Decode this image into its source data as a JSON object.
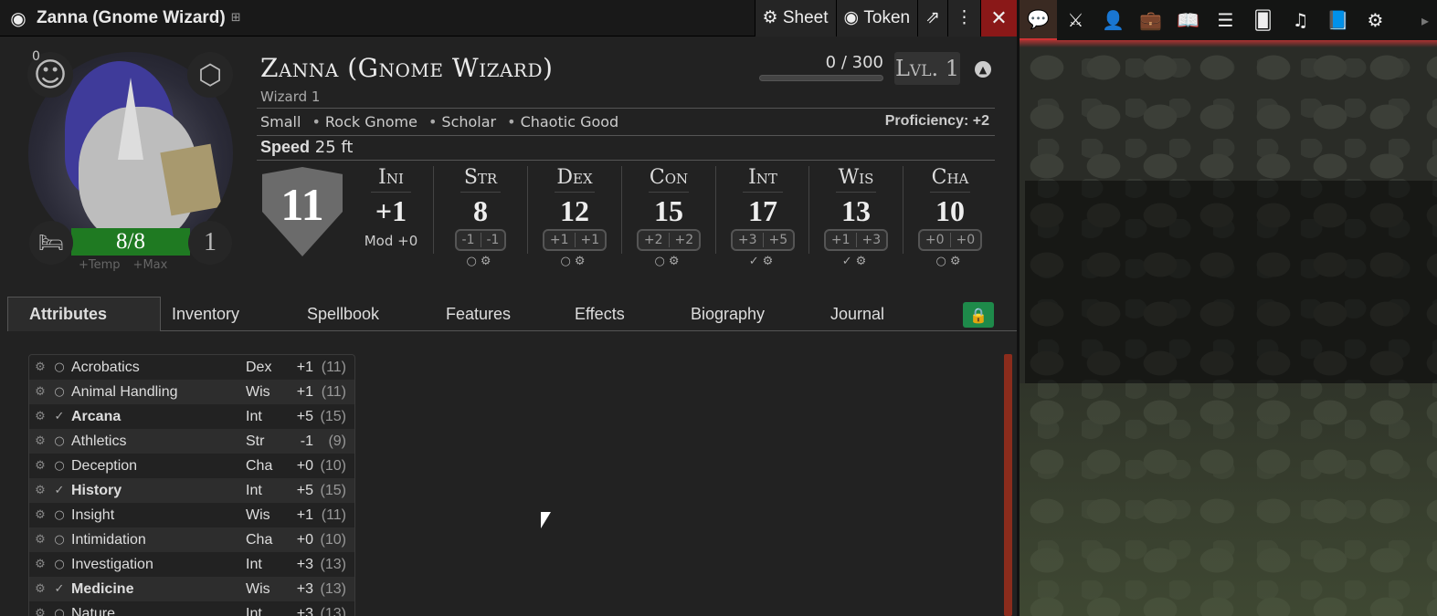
{
  "window": {
    "title": "Zanna (Gnome Wizard)",
    "sheet_label": "Sheet",
    "token_label": "Token"
  },
  "header": {
    "name": "Zanna (Gnome Wizard)",
    "class_line": "Wizard 1",
    "xp": "0 / 300",
    "level": "Lvl. 1",
    "inspiration": "0",
    "hp": "8/8",
    "exhaustion": "1",
    "temp_label": "+Temp",
    "max_label": "+Max",
    "traits": [
      "Small",
      "Rock Gnome",
      "Scholar",
      "Chaotic Good"
    ],
    "proficiency": "Proficiency: +2",
    "speed_label": "Speed",
    "speed_value": "25 ft",
    "ac": "11"
  },
  "initiative": {
    "label": "Ini",
    "value": "+1",
    "mod": "Mod +0"
  },
  "abilities": [
    {
      "label": "Str",
      "score": "8",
      "mod": "-1",
      "save": "-1",
      "proficient": false
    },
    {
      "label": "Dex",
      "score": "12",
      "mod": "+1",
      "save": "+1",
      "proficient": false
    },
    {
      "label": "Con",
      "score": "15",
      "mod": "+2",
      "save": "+2",
      "proficient": false
    },
    {
      "label": "Int",
      "score": "17",
      "mod": "+3",
      "save": "+5",
      "proficient": true
    },
    {
      "label": "Wis",
      "score": "13",
      "mod": "+1",
      "save": "+3",
      "proficient": true
    },
    {
      "label": "Cha",
      "score": "10",
      "mod": "+0",
      "save": "+0",
      "proficient": false
    }
  ],
  "tabs": [
    "Attributes",
    "Inventory",
    "Spellbook",
    "Features",
    "Effects",
    "Biography",
    "Journal"
  ],
  "skills": [
    {
      "name": "Acrobatics",
      "ability": "Dex",
      "mod": "+1",
      "passive": "(11)",
      "prof": false
    },
    {
      "name": "Animal Handling",
      "ability": "Wis",
      "mod": "+1",
      "passive": "(11)",
      "prof": false
    },
    {
      "name": "Arcana",
      "ability": "Int",
      "mod": "+5",
      "passive": "(15)",
      "prof": true
    },
    {
      "name": "Athletics",
      "ability": "Str",
      "mod": "-1",
      "passive": "(9)",
      "prof": false
    },
    {
      "name": "Deception",
      "ability": "Cha",
      "mod": "+0",
      "passive": "(10)",
      "prof": false
    },
    {
      "name": "History",
      "ability": "Int",
      "mod": "+5",
      "passive": "(15)",
      "prof": true
    },
    {
      "name": "Insight",
      "ability": "Wis",
      "mod": "+1",
      "passive": "(11)",
      "prof": false
    },
    {
      "name": "Intimidation",
      "ability": "Cha",
      "mod": "+0",
      "passive": "(10)",
      "prof": false
    },
    {
      "name": "Investigation",
      "ability": "Int",
      "mod": "+3",
      "passive": "(13)",
      "prof": false
    },
    {
      "name": "Medicine",
      "ability": "Wis",
      "mod": "+3",
      "passive": "(13)",
      "prof": true
    },
    {
      "name": "Nature",
      "ability": "Int",
      "mod": "+3",
      "passive": "(13)",
      "prof": false
    }
  ],
  "colors": {
    "hp_bar": "#1f7a22",
    "close": "#8a1818",
    "lock": "#1e8a4a",
    "scrollbar": "#8b2c1c"
  },
  "toolbar_icons": [
    "chat-icon",
    "combat-icon",
    "actors-icon",
    "items-icon",
    "journal-icon",
    "tables-icon",
    "cards-icon",
    "playlists-icon",
    "compendium-icon",
    "settings-icon"
  ]
}
